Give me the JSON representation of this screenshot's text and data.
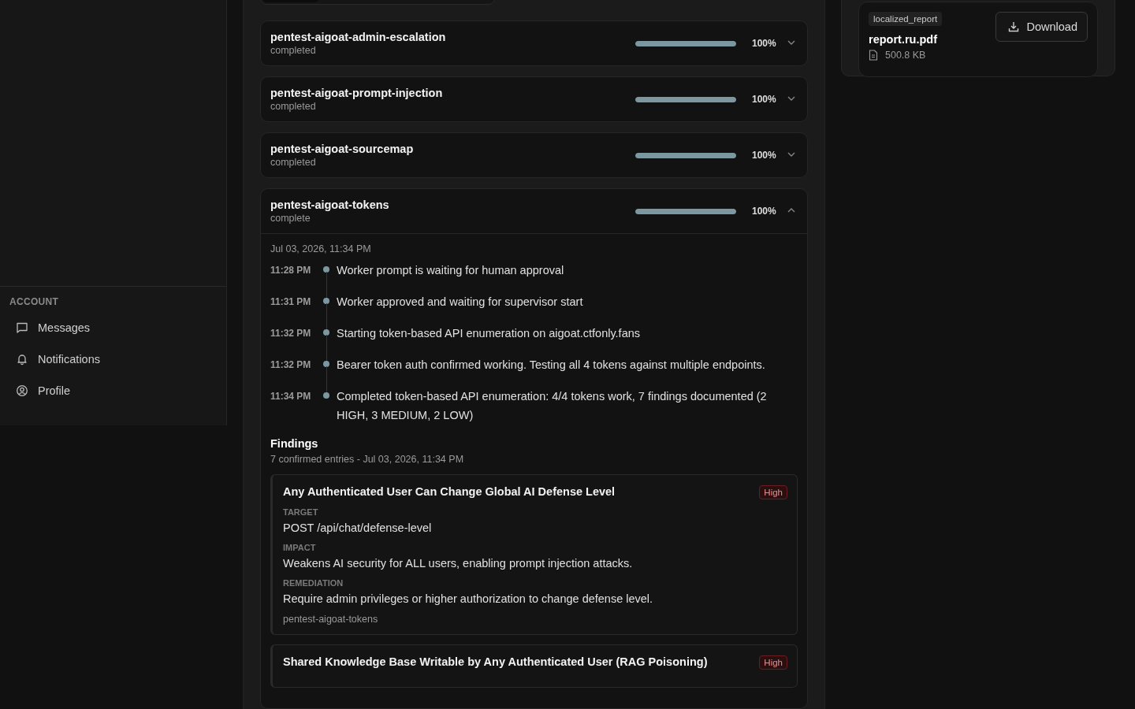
{
  "sidebar": {
    "section_title": "ACCOUNT",
    "items": [
      {
        "label": "Messages",
        "selected": false
      },
      {
        "label": "Notifications",
        "selected": false
      },
      {
        "label": "Profile",
        "selected": false
      }
    ]
  },
  "jobs": [
    {
      "name": "pentest-aigoat-admin-escalation",
      "status": "completed",
      "level": 1,
      "reading": "100%",
      "expanded": false
    },
    {
      "name": "pentest-aigoat-prompt-injection",
      "status": "completed",
      "level": 1,
      "reading": "100%",
      "expanded": false
    },
    {
      "name": "pentest-aigoat-sourcemap",
      "status": "completed",
      "level": 1,
      "reading": "100%",
      "expanded": false
    },
    {
      "name": "pentest-aigoat-tokens",
      "status": "complete",
      "level": 1,
      "reading": "100%",
      "expanded": true,
      "detail": {
        "date": "Jul 03, 2026, 11:34 PM",
        "timeline": [
          {
            "time": "11:28 PM",
            "text": "Worker prompt is waiting for human approval"
          },
          {
            "time": "11:31 PM",
            "text": "Worker approved and waiting for supervisor start"
          },
          {
            "time": "11:32 PM",
            "text": "Starting token-based API enumeration on aigoat.ctfonly.fans"
          },
          {
            "time": "11:32 PM",
            "text": "Bearer token auth confirmed working. Testing all 4 tokens against multiple endpoints."
          },
          {
            "time": "11:34 PM",
            "text": "Completed token-based API enumeration: 4/4 tokens work, 7 findings documented (2 HIGH, 3 MEDIUM, 2 LOW)"
          }
        ],
        "findings": {
          "title": "Findings",
          "subtitle": "7 confirmed entries - Jul 03, 2026, 11:34 PM",
          "items": [
            {
              "title": "Any Authenticated User Can Change Global AI Defense Level",
              "severity": "High",
              "fields": [
                {
                  "label": "TARGET",
                  "value": "POST /api/chat/defense-level"
                },
                {
                  "label": "IMPACT",
                  "value": "Weakens AI security for ALL users, enabling prompt injection attacks."
                },
                {
                  "label": "REMEDIATION",
                  "value": "Require admin privileges or higher authorization to change defense level."
                }
              ],
              "source": "pentest-aigoat-tokens"
            },
            {
              "title": "Shared Knowledge Base Writable by Any Authenticated User (RAG Poisoning)",
              "severity": "High"
            }
          ]
        }
      }
    }
  ],
  "file": {
    "tag": "localized_report",
    "name": "report.ru.pdf",
    "size": "500.8 KB",
    "button": "Download"
  }
}
